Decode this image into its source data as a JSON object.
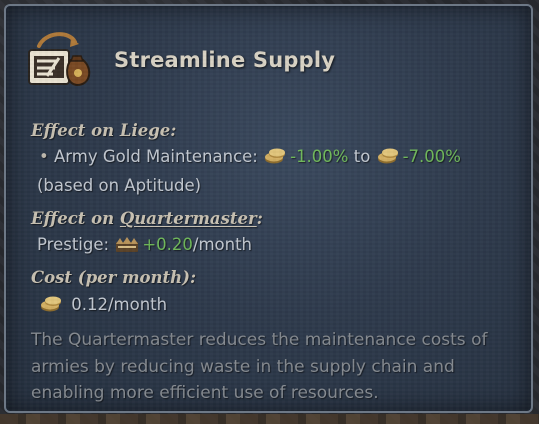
{
  "tooltip": {
    "icon": "supply-crate-and-gold-sack-icon",
    "title": "Streamline Supply",
    "liege": {
      "heading": "Effect on Liege:",
      "bullet": "•",
      "modifier_label": "Army Gold Maintenance:",
      "min_value": "-1.00%",
      "between": "to",
      "max_value": "-7.00%",
      "note": "(based on Aptitude)"
    },
    "quartermaster": {
      "heading_prefix": "Effect on",
      "heading_link": "Quartermaster",
      "heading_suffix": ":",
      "modifier_label": "Prestige:",
      "value": "+0.20",
      "unit": "/month"
    },
    "cost": {
      "heading": "Cost (per month):",
      "value": "0.12/month"
    },
    "description": "The Quartermaster reduces the maintenance costs of armies by reducing waste in the supply chain and enabling more efficient use of resources."
  },
  "colors": {
    "positive": "#6fb85a",
    "neutral_value": "#c2c8d0",
    "flavor_text": "#858a90",
    "title": "#d9d3c5"
  }
}
